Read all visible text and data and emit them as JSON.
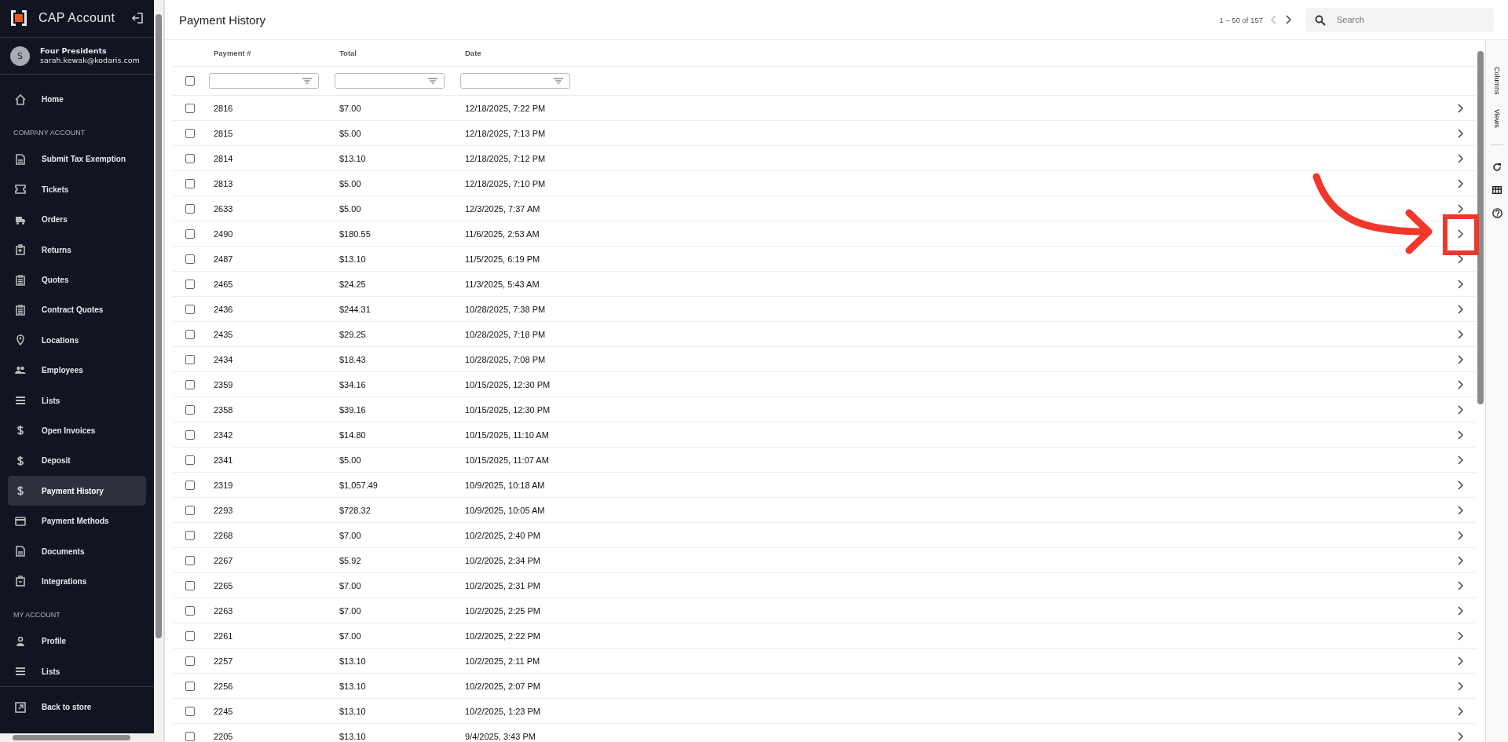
{
  "sidebar": {
    "app_title": "CAP Account",
    "user": {
      "avatar": "S",
      "company": "Four Presidents",
      "email": "sarah.kewak@kodaris.com"
    },
    "sections": [
      {
        "items": [
          {
            "label": "Home",
            "kind": "home",
            "selected": false
          }
        ]
      },
      {
        "heading": "COMPANY ACCOUNT",
        "items": [
          {
            "label": "Submit Tax Exemption",
            "kind": "doc",
            "selected": false
          },
          {
            "label": "Tickets",
            "kind": "ticket",
            "selected": false
          },
          {
            "label": "Orders",
            "kind": "truck",
            "selected": false
          },
          {
            "label": "Returns",
            "kind": "return",
            "selected": false
          },
          {
            "label": "Quotes",
            "kind": "clipboard",
            "selected": false
          },
          {
            "label": "Contract Quotes",
            "kind": "clipboard",
            "selected": false
          },
          {
            "label": "Locations",
            "kind": "pin",
            "selected": false
          },
          {
            "label": "Employees",
            "kind": "people",
            "selected": false
          },
          {
            "label": "Lists",
            "kind": "list",
            "selected": false
          },
          {
            "label": "Open Invoices",
            "kind": "dollar",
            "selected": false
          },
          {
            "label": "Deposit",
            "kind": "dollar",
            "selected": false
          },
          {
            "label": "Payment History",
            "kind": "dollar",
            "selected": true
          },
          {
            "label": "Payment Methods",
            "kind": "card",
            "selected": false
          },
          {
            "label": "Documents",
            "kind": "doc",
            "selected": false
          },
          {
            "label": "Integrations",
            "kind": "integration",
            "selected": false
          }
        ]
      },
      {
        "heading": "MY ACCOUNT",
        "items": [
          {
            "label": "Profile",
            "kind": "person",
            "selected": false
          },
          {
            "label": "Lists",
            "kind": "list",
            "selected": false
          }
        ]
      }
    ],
    "footer_link": "Back to store"
  },
  "page": {
    "title": "Payment History",
    "pagination": "1 – 50 of 157",
    "search": {
      "placeholder": "Search"
    }
  },
  "table": {
    "columns": [
      "Payment #",
      "Total",
      "Date"
    ],
    "select_all": {
      "checked": false
    },
    "rows": [
      {
        "cells": [
          "2816",
          "$7.00",
          "12/18/2025, 7:22 PM"
        ],
        "selected": false
      },
      {
        "cells": [
          "2815",
          "$5.00",
          "12/18/2025, 7:13 PM"
        ],
        "selected": false
      },
      {
        "cells": [
          "2814",
          "$13.10",
          "12/18/2025, 7:12 PM"
        ],
        "selected": false
      },
      {
        "cells": [
          "2813",
          "$5.00",
          "12/18/2025, 7:10 PM"
        ],
        "selected": false
      },
      {
        "cells": [
          "2633",
          "$5.00",
          "12/3/2025, 7:37 AM"
        ],
        "selected": false
      },
      {
        "cells": [
          "2490",
          "$180.55",
          "11/6/2025, 2:53 AM"
        ],
        "selected": false
      },
      {
        "cells": [
          "2487",
          "$13.10",
          "11/5/2025, 6:19 PM"
        ],
        "selected": false
      },
      {
        "cells": [
          "2465",
          "$24.25",
          "11/3/2025, 5:43 AM"
        ],
        "selected": false
      },
      {
        "cells": [
          "2436",
          "$244.31",
          "10/28/2025, 7:38 PM"
        ],
        "selected": false
      },
      {
        "cells": [
          "2435",
          "$29.25",
          "10/28/2025, 7:18 PM"
        ],
        "selected": false
      },
      {
        "cells": [
          "2434",
          "$18.43",
          "10/28/2025, 7:08 PM"
        ],
        "selected": false
      },
      {
        "cells": [
          "2359",
          "$34.16",
          "10/15/2025, 12:30 PM"
        ],
        "selected": false
      },
      {
        "cells": [
          "2358",
          "$39.16",
          "10/15/2025, 12:30 PM"
        ],
        "selected": false
      },
      {
        "cells": [
          "2342",
          "$14.80",
          "10/15/2025, 11:10 AM"
        ],
        "selected": false
      },
      {
        "cells": [
          "2341",
          "$5.00",
          "10/15/2025, 11:07 AM"
        ],
        "selected": false
      },
      {
        "cells": [
          "2319",
          "$1,057.49",
          "10/9/2025, 10:18 AM"
        ],
        "selected": false
      },
      {
        "cells": [
          "2293",
          "$728.32",
          "10/9/2025, 10:05 AM"
        ],
        "selected": false
      },
      {
        "cells": [
          "2268",
          "$7.00",
          "10/2/2025, 2:40 PM"
        ],
        "selected": false
      },
      {
        "cells": [
          "2267",
          "$5.92",
          "10/2/2025, 2:34 PM"
        ],
        "selected": false
      },
      {
        "cells": [
          "2265",
          "$7.00",
          "10/2/2025, 2:31 PM"
        ],
        "selected": false
      },
      {
        "cells": [
          "2263",
          "$7.00",
          "10/2/2025, 2:25 PM"
        ],
        "selected": false
      },
      {
        "cells": [
          "2261",
          "$7.00",
          "10/2/2025, 2:22 PM"
        ],
        "selected": false
      },
      {
        "cells": [
          "2257",
          "$13.10",
          "10/2/2025, 2:11 PM"
        ],
        "selected": false
      },
      {
        "cells": [
          "2256",
          "$13.10",
          "10/2/2025, 2:07 PM"
        ],
        "selected": false
      },
      {
        "cells": [
          "2245",
          "$13.10",
          "10/2/2025, 1:23 PM"
        ],
        "selected": false
      },
      {
        "cells": [
          "2205",
          "$13.10",
          "9/4/2025, 3:43 PM"
        ],
        "selected": false
      }
    ]
  },
  "side_panel": {
    "tabs": [
      "Columns",
      "Views"
    ]
  }
}
